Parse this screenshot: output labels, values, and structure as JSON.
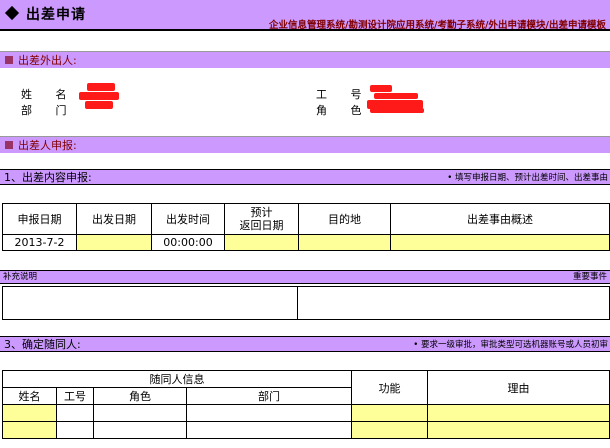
{
  "header": {
    "title": "出差申请",
    "nav": [
      "企业信息管理系统",
      "勘测设计院应用系统",
      "考勤子系统",
      "外出申请模块",
      "出差申请模板"
    ],
    "separator": "/"
  },
  "traveler_section": {
    "heading": "出差外出人:",
    "name_label": "姓 名",
    "dept_label": "部 门",
    "id_label": "工 号",
    "role_label": "角 色"
  },
  "applicant_section": {
    "heading": "出差人申报:"
  },
  "content_section": {
    "heading": "1、出差内容申报:",
    "note": "• 填写申报日期、预计出差时间、出差事由",
    "columns": [
      "申报日期",
      "出发日期",
      "出发时间",
      "预计\n返回日期",
      "目的地",
      "出差事由概述"
    ],
    "row": {
      "report_date": "2013-7-2",
      "depart_date": "",
      "depart_time": "00:00:00",
      "return_date": "",
      "destination": "",
      "reason": ""
    }
  },
  "supplement": {
    "label": "补充说明",
    "right_label": "重要事件"
  },
  "companion_section": {
    "heading": "3、确定随同人:",
    "note": "• 要求一级审批，审批类型可选机器账号或人员初审",
    "group_header": "随同人信息",
    "columns": [
      "姓名",
      "工号",
      "角色",
      "部门"
    ],
    "function_label": "功能",
    "reason_label": "理由"
  },
  "colors": {
    "header_bg": "#cc99ff",
    "accent": "#800000",
    "input_bg": "#ffff99",
    "redaction": "#ff1a1a"
  }
}
